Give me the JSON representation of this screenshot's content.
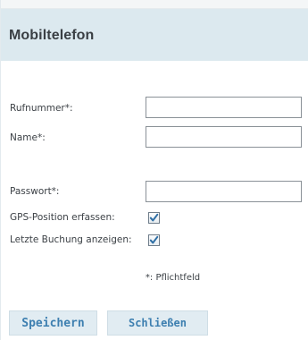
{
  "dialog": {
    "title": "Mobiltelefon"
  },
  "form": {
    "phone": {
      "label": "Rufnummer*:",
      "value": ""
    },
    "name": {
      "label": "Name*:",
      "value": ""
    },
    "password": {
      "label": "Passwort*:",
      "value": ""
    },
    "gps": {
      "label": "GPS-Position erfassen:",
      "checked": true
    },
    "last_booking": {
      "label": "Letzte Buchung anzeigen:",
      "checked": true
    },
    "required_hint": "*: Pflichtfeld"
  },
  "buttons": {
    "save_label": "Speichern",
    "close_label": "Schließen"
  },
  "colors": {
    "header_background": "#dce9ef",
    "button_background": "#e1ecf2",
    "button_text": "#3d7fb0",
    "checkmark": "#2f6fa5"
  },
  "icons": {
    "checkbox_checked": "checkmark-icon"
  }
}
